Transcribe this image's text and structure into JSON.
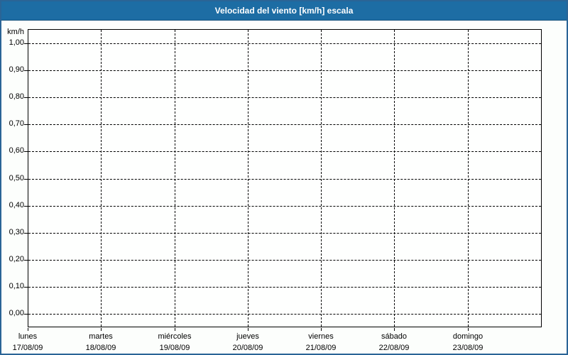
{
  "window": {
    "title": "Velocidad del viento [km/h] escala"
  },
  "colors": {
    "titlebar_bg": "#1d6da4",
    "titlebar_text": "#ffffff",
    "frame_border": "#2a6496",
    "page_bg": "#fcfefc",
    "plot_bg": "#fefffe",
    "grid": "#000000"
  },
  "chart_data": {
    "type": "line",
    "title": "Velocidad del viento [km/h] escala",
    "xlabel": "",
    "ylabel": "km/h",
    "ylim": [
      0.0,
      1.0
    ],
    "y_tick_step": 0.1,
    "grid": "dashed",
    "legend": "none",
    "y_ticks": [
      {
        "value": 1.0,
        "label": "1,00"
      },
      {
        "value": 0.9,
        "label": "0,90"
      },
      {
        "value": 0.8,
        "label": "0,80"
      },
      {
        "value": 0.7,
        "label": "0,70"
      },
      {
        "value": 0.6,
        "label": "0,60"
      },
      {
        "value": 0.5,
        "label": "0,50"
      },
      {
        "value": 0.4,
        "label": "0,40"
      },
      {
        "value": 0.3,
        "label": "0,30"
      },
      {
        "value": 0.2,
        "label": "0,20"
      },
      {
        "value": 0.1,
        "label": "0,10"
      },
      {
        "value": 0.0,
        "label": "0,00"
      }
    ],
    "x_categories": [
      {
        "day": "lunes",
        "date": "17/08/09"
      },
      {
        "day": "martes",
        "date": "18/08/09"
      },
      {
        "day": "miércoles",
        "date": "19/08/09"
      },
      {
        "day": "jueves",
        "date": "20/08/09"
      },
      {
        "day": "viernes",
        "date": "21/08/09"
      },
      {
        "day": "sábado",
        "date": "22/08/09"
      },
      {
        "day": "domingo",
        "date": "23/08/09"
      }
    ],
    "series": []
  }
}
